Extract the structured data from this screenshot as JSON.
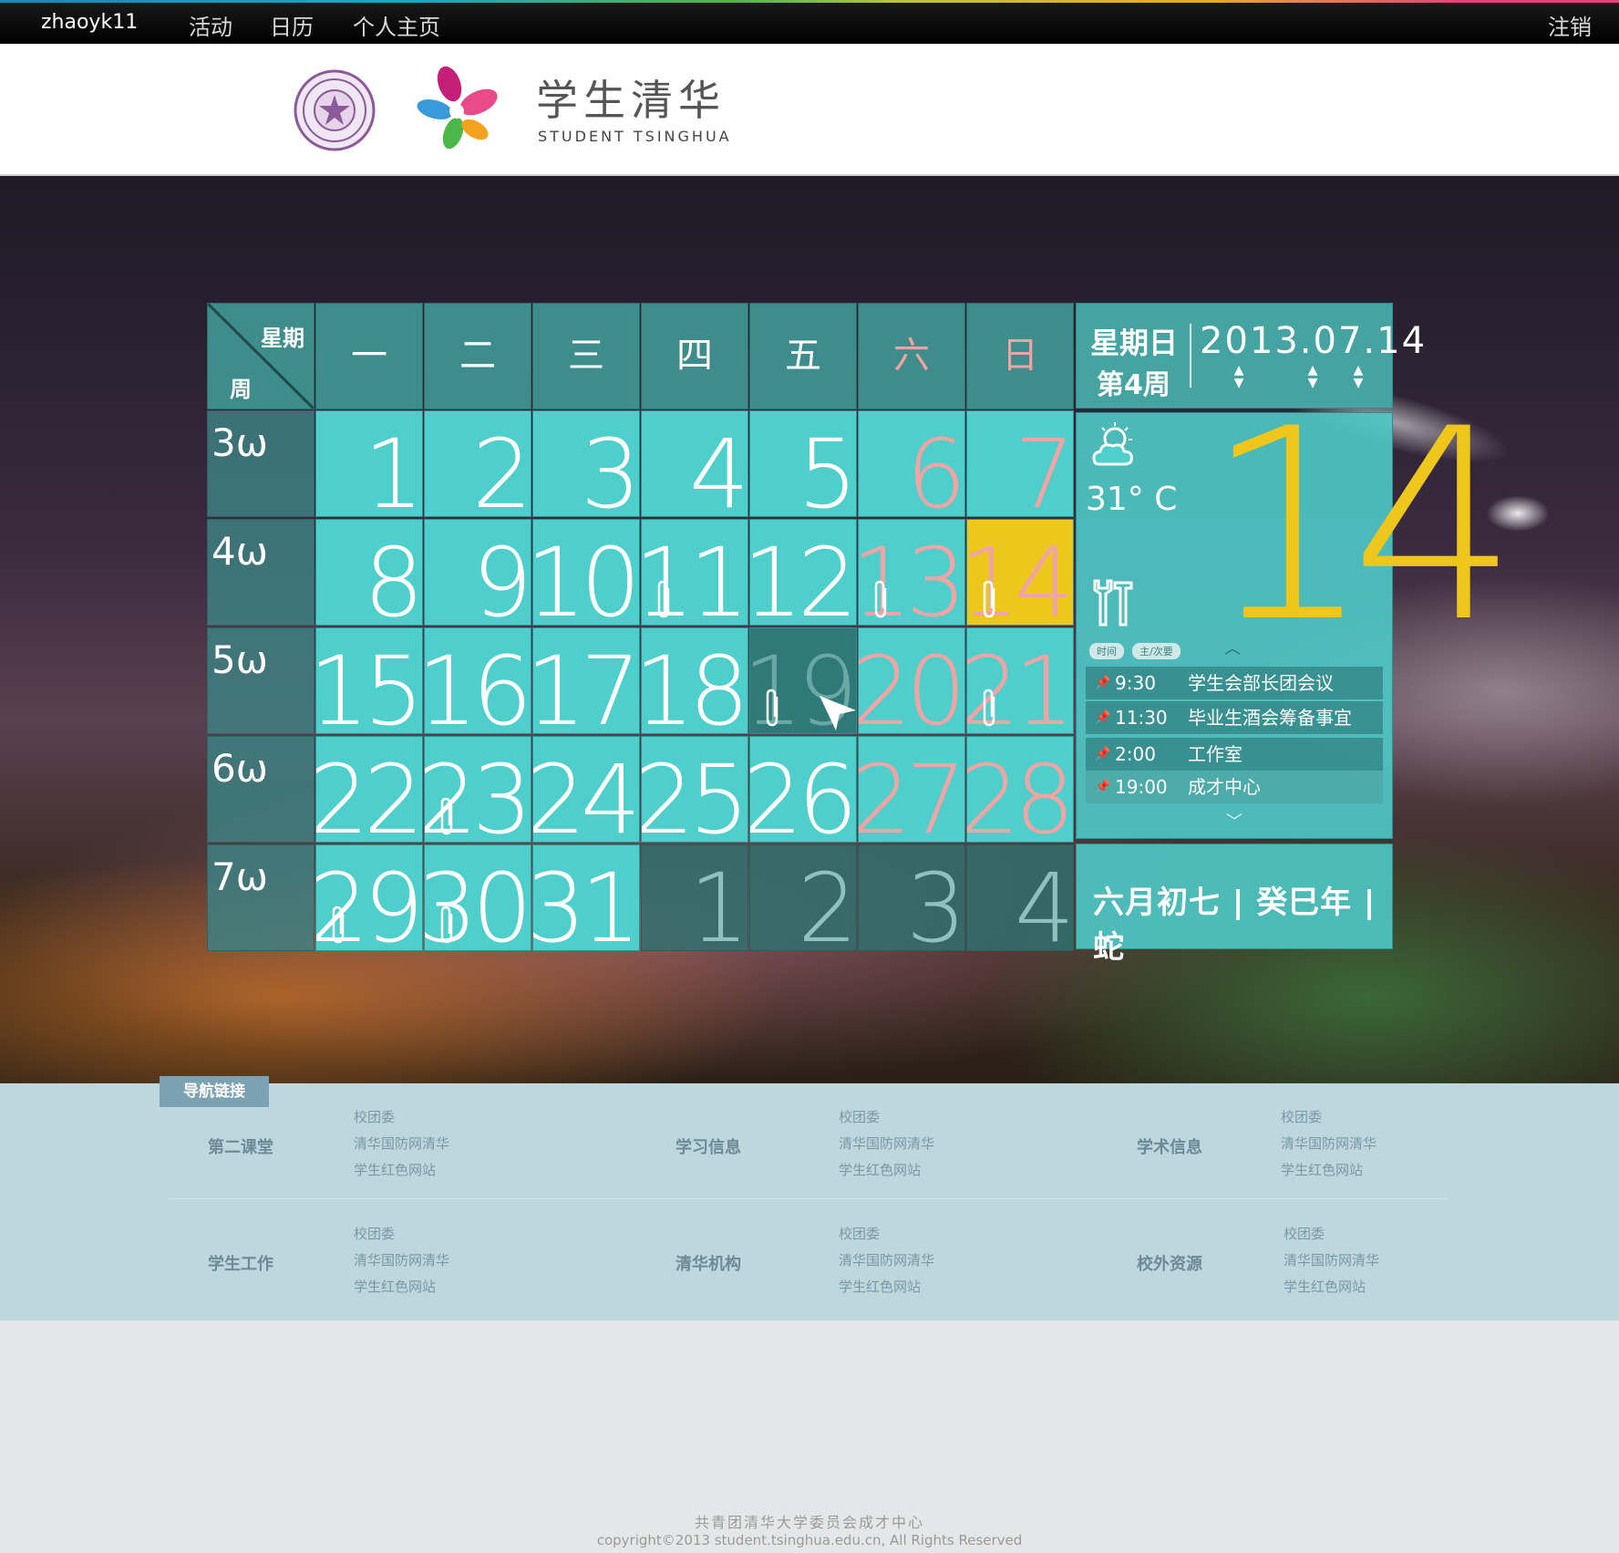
{
  "topbar": {
    "username": "zhaoyk11",
    "nav": [
      "活动",
      "日历",
      "个人主页"
    ],
    "logout": "注销"
  },
  "header": {
    "brand_cn": "学生清华",
    "brand_en": "STUDENT TSINGHUA"
  },
  "calendar": {
    "corner": {
      "top": "星期",
      "bottom": "周"
    },
    "weekdays": [
      "一",
      "二",
      "三",
      "四",
      "五",
      "六",
      "日"
    ],
    "weeks": [
      "3ω",
      "4ω",
      "5ω",
      "6ω",
      "7ω"
    ],
    "days": [
      [
        "1",
        "2",
        "3",
        "4",
        "5",
        "6",
        "7"
      ],
      [
        "8",
        "9",
        "10",
        "11",
        "12",
        "13",
        "14"
      ],
      [
        "15",
        "16",
        "17",
        "18",
        "19",
        "20",
        "21"
      ],
      [
        "22",
        "23",
        "24",
        "25",
        "26",
        "27",
        "28"
      ],
      [
        "29",
        "30",
        "31",
        "1",
        "2",
        "3",
        "4"
      ]
    ]
  },
  "panel": {
    "weekday": "星期日",
    "week": "第4周",
    "date": "2013.07.14",
    "temperature": "31° C",
    "day_big": "14",
    "tabs": [
      "时间",
      "主/次要"
    ],
    "schedule": [
      {
        "time": "9:30",
        "title": "学生会部长团会议",
        "pin": "#dfe9e9"
      },
      {
        "time": "11:30",
        "title": "毕业生酒会筹备事宜",
        "pin": "#dfe9e9"
      },
      {
        "time": "2:00",
        "title": "工作室",
        "pin": "#d9302c"
      },
      {
        "time": "19:00",
        "title": "成才中心",
        "pin": "#e8e23a"
      }
    ],
    "lunar": "六月初七 | 癸巳年 | 蛇"
  },
  "links": {
    "tag": "导航链接",
    "groups": [
      {
        "title": "第二课堂",
        "items": [
          "校团委",
          "清华国防网清华",
          "学生红色网站"
        ]
      },
      {
        "title": "学习信息",
        "items": [
          "校团委",
          "清华国防网清华",
          "学生红色网站"
        ]
      },
      {
        "title": "学术信息",
        "items": [
          "校团委",
          "清华国防网清华",
          "学生红色网站"
        ]
      },
      {
        "title": "学生工作",
        "items": [
          "校团委",
          "清华国防网清华",
          "学生红色网站"
        ]
      },
      {
        "title": "清华机构",
        "items": [
          "校团委",
          "清华国防网清华",
          "学生红色网站"
        ]
      },
      {
        "title": "校外资源",
        "items": [
          "校团委",
          "清华国防网清华",
          "学生红色网站"
        ]
      }
    ]
  },
  "footer": {
    "line1": "共青团清华大学委员会成才中心",
    "line2": "copyright©2013 student.tsinghua.edu.cn, All Rights Reserved"
  },
  "colors": {
    "accent": "#4ecfcb",
    "today": "#edc81c",
    "weekend": "#f0a4a4"
  }
}
